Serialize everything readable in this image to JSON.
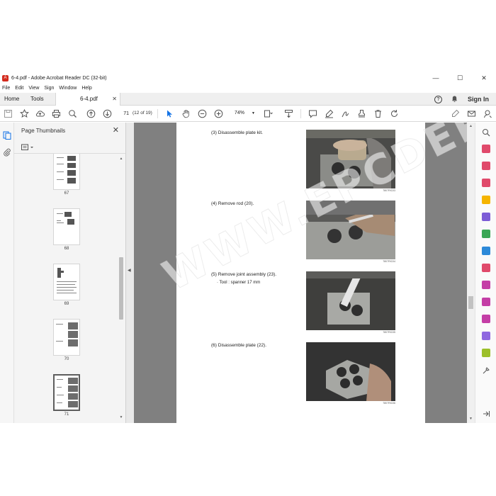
{
  "window": {
    "title": "6-4.pdf - Adobe Acrobat Reader DC (32-bit)",
    "app_icon": "acrobat-icon",
    "controls": [
      "—",
      "☐",
      "✕"
    ]
  },
  "menu": [
    "File",
    "Edit",
    "View",
    "Sign",
    "Window",
    "Help"
  ],
  "tabs": {
    "home": "Home",
    "tools": "Tools",
    "document": "6-4.pdf",
    "close": "✕",
    "sign_in": "Sign In",
    "help": "?"
  },
  "toolbar": {
    "page_number": "71",
    "page_count": "(12 of 19)",
    "zoom": "74%",
    "zoom_chevron": "▼",
    "accent_color": "#1473e6"
  },
  "panel": {
    "title": "Page Thumbnails",
    "close": "✕",
    "thumbnails": [
      {
        "label": "67"
      },
      {
        "label": "68"
      },
      {
        "label": "69"
      },
      {
        "label": "70"
      },
      {
        "label": "71",
        "selected": true
      }
    ]
  },
  "document": {
    "steps": [
      {
        "text": "(3) Disassemble plate kit.",
        "caption": "7807RIC03"
      },
      {
        "text": "(4) Remove rod (20).",
        "caption": "7807RIC04"
      },
      {
        "text": "(5) Remove joint assembly (23).",
        "tool": "· Tool : spanner 17 mm",
        "caption": "7807RIC05"
      },
      {
        "text": "(6) Disassemble plate (22).",
        "caption": "7807RIC06"
      }
    ],
    "watermark": "WWW.EPCDEPO.COM"
  }
}
